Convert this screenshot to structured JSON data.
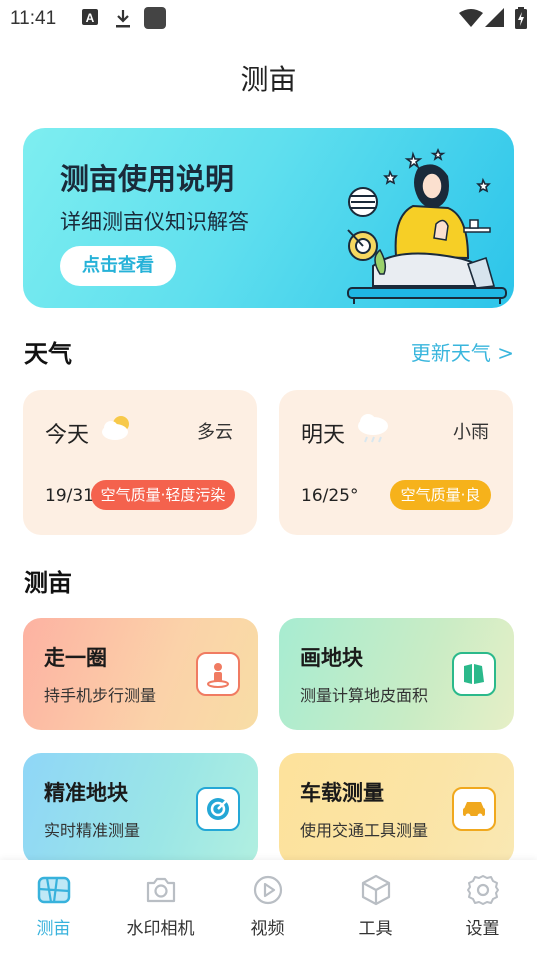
{
  "status_bar": {
    "time": "11:41"
  },
  "header": {
    "title": "测亩"
  },
  "banner": {
    "title": "测亩使用说明",
    "subtitle": "详细测亩仪知识解答",
    "button_label": "点击查看"
  },
  "weather_section": {
    "title": "天气",
    "update_link": "更新天气 >",
    "cards": [
      {
        "day": "今天",
        "condition": "多云",
        "temp": "19/31",
        "air_quality": "空气质量·轻度污染",
        "badge_color": "#f4624d"
      },
      {
        "day": "明天",
        "condition": "小雨",
        "temp": "16/25°",
        "air_quality": "空气质量·良",
        "badge_color": "#f6b21b"
      }
    ]
  },
  "measure_section": {
    "title": "测亩",
    "features": [
      {
        "title": "走一圈",
        "subtitle": "持手机步行测量",
        "icon": "walking-person-icon"
      },
      {
        "title": "画地块",
        "subtitle": "测量计算地皮面积",
        "icon": "map-plot-icon"
      },
      {
        "title": "精准地块",
        "subtitle": "实时精准测量",
        "icon": "target-icon"
      },
      {
        "title": "车载测量",
        "subtitle": "使用交通工具测量",
        "icon": "car-icon"
      }
    ]
  },
  "tabbar": {
    "tabs": [
      {
        "label": "测亩",
        "icon": "map-icon",
        "active": true
      },
      {
        "label": "水印相机",
        "icon": "camera-icon"
      },
      {
        "label": "视频",
        "icon": "play-icon"
      },
      {
        "label": "工具",
        "icon": "box-icon"
      },
      {
        "label": "设置",
        "icon": "gear-icon"
      }
    ]
  }
}
